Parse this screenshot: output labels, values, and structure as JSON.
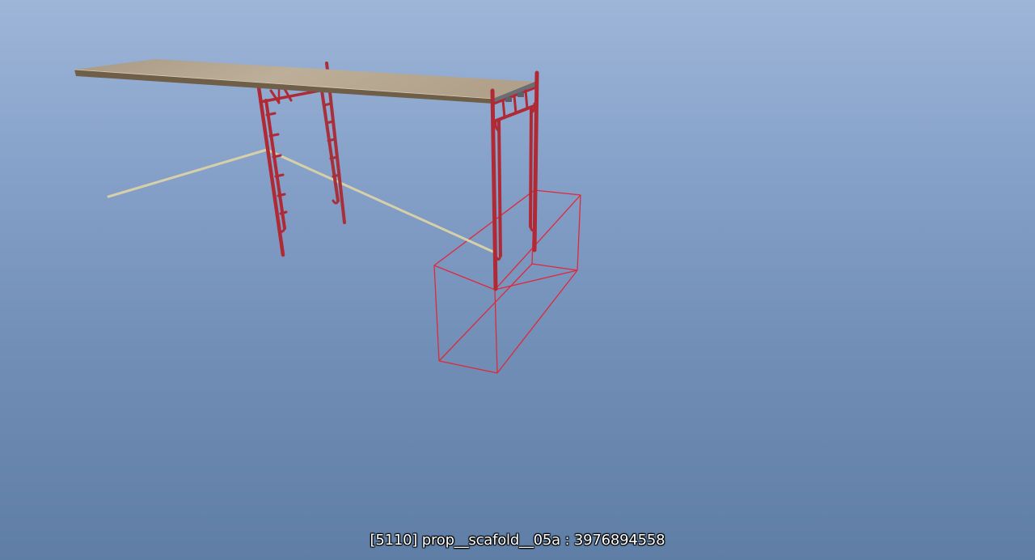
{
  "viewer": {
    "caption": "[5110] prop__scafold__05a : 3976894558"
  },
  "colors": {
    "scaffold_red": "#b02a35",
    "bounding_box": "#e0283c",
    "plank": "#b8a890",
    "rope": "#d6cfa8"
  },
  "selection": {
    "object_index": "5110",
    "model_name": "prop__scafold__05a",
    "model_hash": "3976894558"
  }
}
